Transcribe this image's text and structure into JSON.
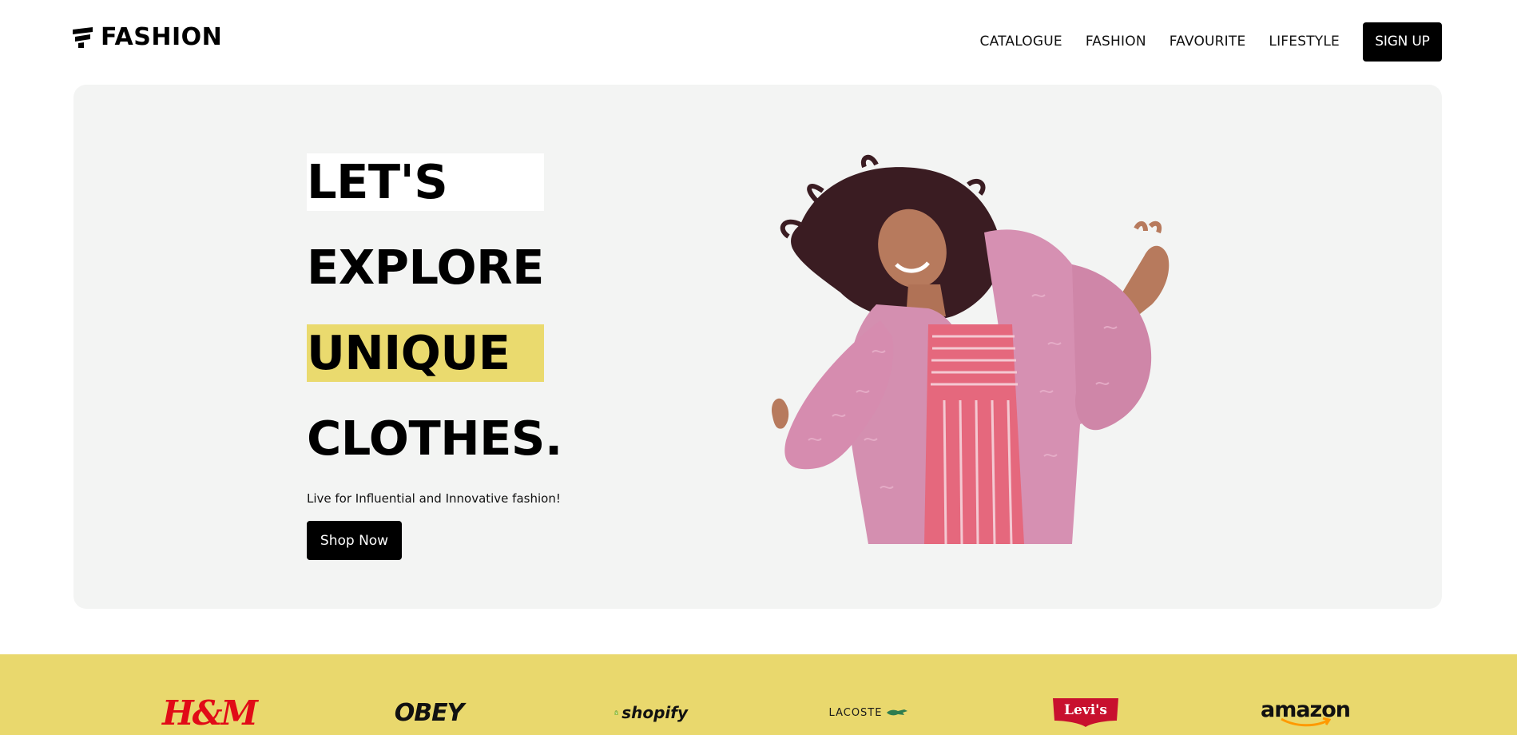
{
  "header": {
    "logo_text": "FASHION",
    "logo_icon": "fashion-logo-icon",
    "nav": [
      {
        "label": "CATALOGUE"
      },
      {
        "label": "FASHION"
      },
      {
        "label": "FAVOURITE"
      },
      {
        "label": "LIFESTYLE"
      }
    ],
    "signup_label": "SIGN UP"
  },
  "hero": {
    "headline": [
      "LET'S",
      "EXPLORE",
      "UNIQUE",
      "CLOTHES."
    ],
    "subtitle": "Live for Influential and Innovative fashion!",
    "cta_label": "Shop Now",
    "image": "woman-in-pink-fur-coat-dancing"
  },
  "brands": [
    {
      "name": "H&M",
      "text": "H&M",
      "color": "#e10b17"
    },
    {
      "name": "OBEY",
      "text": "OBEY",
      "color": "#111111"
    },
    {
      "name": "Shopify",
      "text": "shopify",
      "color": "#95bf47"
    },
    {
      "name": "Lacoste",
      "text": "LACOSTE",
      "color": "#1a1a1a"
    },
    {
      "name": "Levi's",
      "text": "Levi's",
      "color": "#c8102e"
    },
    {
      "name": "Amazon",
      "text": "amazon",
      "color": "#ff9900"
    }
  ],
  "colors": {
    "accent_yellow": "#e9d86d",
    "hero_background": "#f3f4f3",
    "button_black": "#000000"
  }
}
